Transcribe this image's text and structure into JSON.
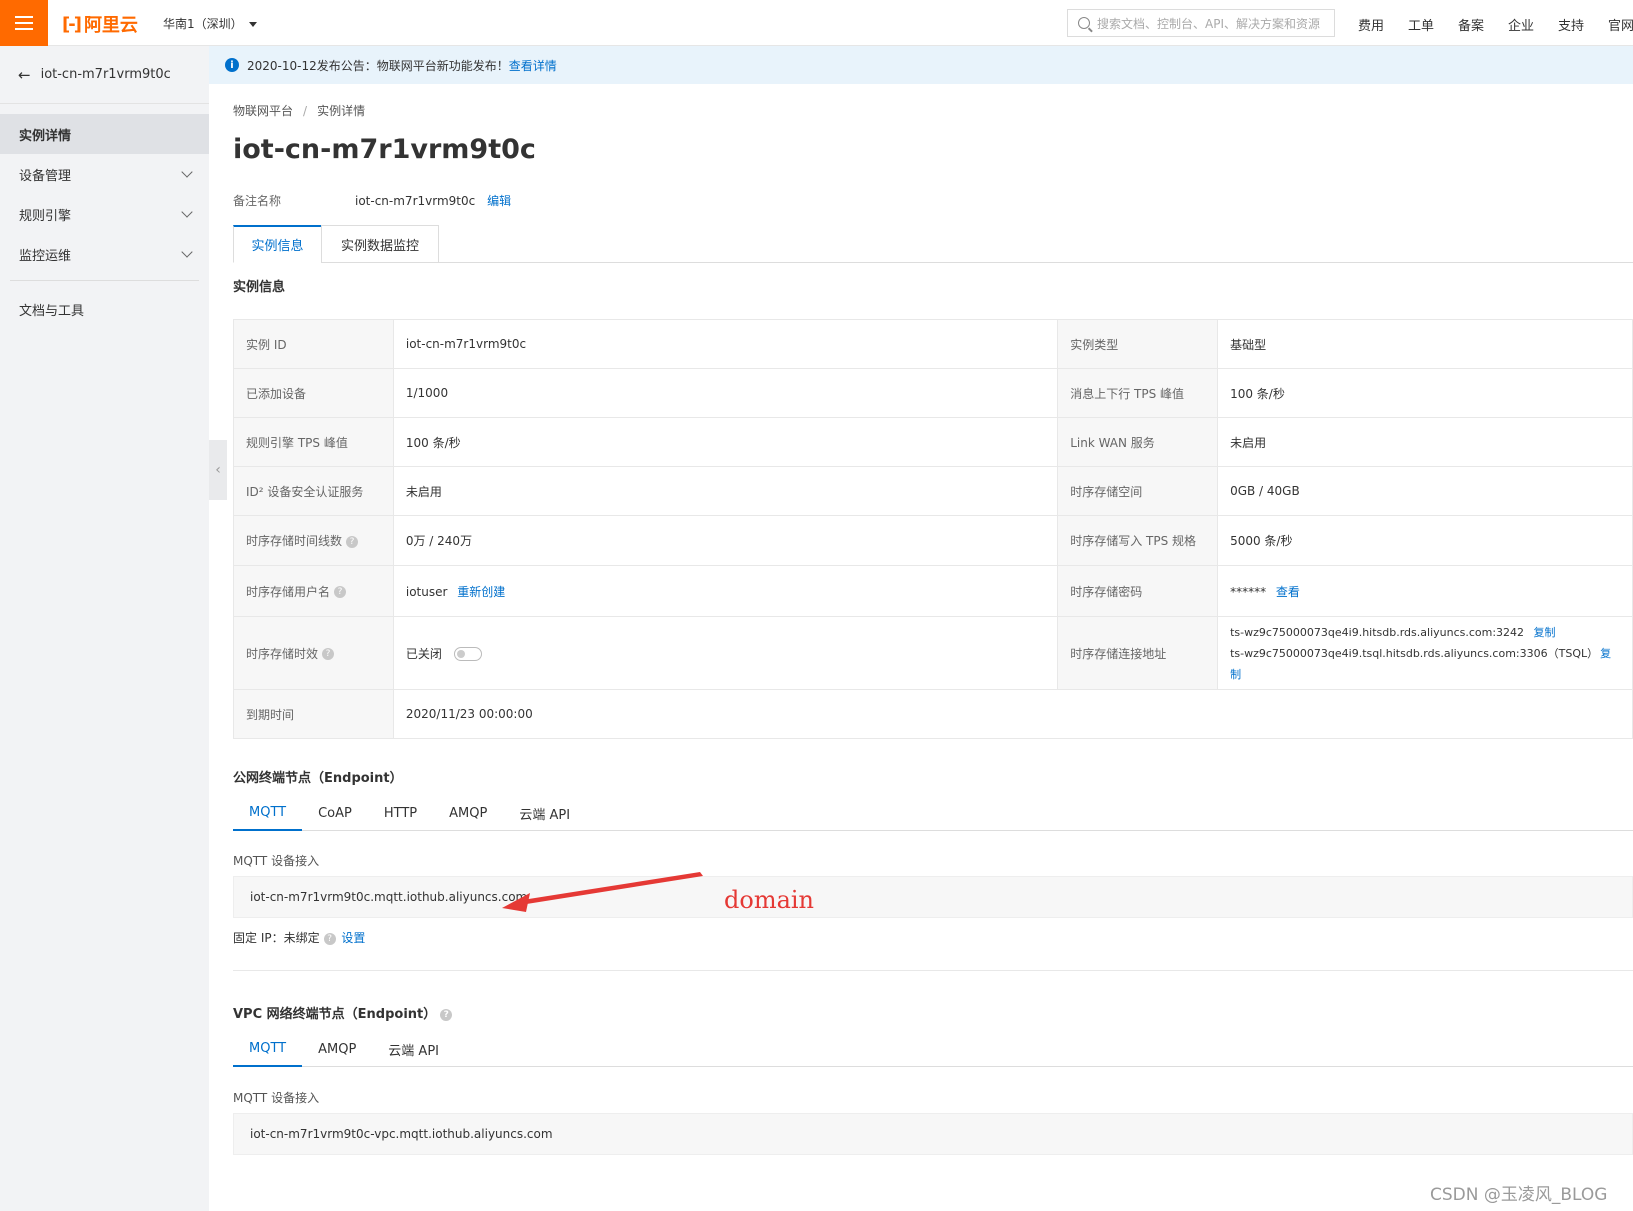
{
  "topbar": {
    "logo_text": "阿里云",
    "region": "华南1（深圳）",
    "search_placeholder": "搜索文档、控制台、API、解决方案和资源",
    "nav": [
      "费用",
      "工单",
      "备案",
      "企业",
      "支持",
      "官网"
    ]
  },
  "sidebar": {
    "back_label": "iot-cn-m7r1vrm9t0c",
    "items": [
      {
        "label": "实例详情"
      },
      {
        "label": "设备管理"
      },
      {
        "label": "规则引擎"
      },
      {
        "label": "监控运维"
      },
      {
        "label": "文档与工具"
      }
    ]
  },
  "notice": {
    "text": "2020-10-12发布公告：物联网平台新功能发布！",
    "link": "查看详情"
  },
  "breadcrumb": [
    "物联网平台",
    "实例详情"
  ],
  "page_title": "iot-cn-m7r1vrm9t0c",
  "remark": {
    "label": "备注名称",
    "value": "iot-cn-m7r1vrm9t0c",
    "edit": "编辑"
  },
  "tabs": [
    "实例信息",
    "实例数据监控"
  ],
  "instance_section_title": "实例信息",
  "info": {
    "rows": [
      {
        "l1": "实例 ID",
        "v1": "iot-cn-m7r1vrm9t0c",
        "l2": "实例类型",
        "v2": "基础型"
      },
      {
        "l1": "已添加设备",
        "v1": "1/1000",
        "l2": "消息上下行 TPS 峰值",
        "v2": "100 条/秒"
      },
      {
        "l1": "规则引擎 TPS 峰值",
        "v1": "100 条/秒",
        "l2": "Link WAN 服务",
        "v2": "未启用"
      },
      {
        "l1": "ID² 设备安全认证服务",
        "v1": "未启用",
        "l2": "时序存储空间",
        "v2": "0GB / 40GB"
      },
      {
        "l1": "时序存储时间线数",
        "v1": "0万 / 240万",
        "l2": "时序存储写入 TPS 规格",
        "v2": "5000 条/秒"
      },
      {
        "l1": "时序存储用户名",
        "v1": "iotuser",
        "v1_link": "重新创建",
        "l2": "时序存储密码",
        "v2": "******",
        "v2_link": "查看"
      },
      {
        "l1": "时序存储时效",
        "v1": "已关闭",
        "l2": "时序存储连接地址",
        "v2a": "ts-wz9c75000073qe4i9.hitsdb.rds.aliyuncs.com:3242",
        "v2b": "ts-wz9c75000073qe4i9.tsql.hitsdb.rds.aliyuncs.com:3306（TSQL）",
        "copy": "复制"
      },
      {
        "l1": "到期时间",
        "v1": "2020/11/23 00:00:00"
      }
    ]
  },
  "public": {
    "title": "公网终端节点（Endpoint）",
    "tabs": [
      "MQTT",
      "CoAP",
      "HTTP",
      "AMQP",
      "云端 API"
    ],
    "label": "MQTT 设备接入",
    "endpoint": "iot-cn-m7r1vrm9t0c.mqtt.iothub.aliyuncs.com",
    "fixed_ip": "固定 IP：未绑定",
    "set": "设置"
  },
  "vpc": {
    "title": "VPC 网络终端节点（Endpoint）",
    "tabs": [
      "MQTT",
      "AMQP",
      "云端 API"
    ],
    "label": "MQTT 设备接入",
    "endpoint": "iot-cn-m7r1vrm9t0c-vpc.mqtt.iothub.aliyuncs.com"
  },
  "annotation": {
    "text": "domain",
    "color": "#e53935"
  },
  "watermark": "CSDN @玉凌风_BLOG"
}
